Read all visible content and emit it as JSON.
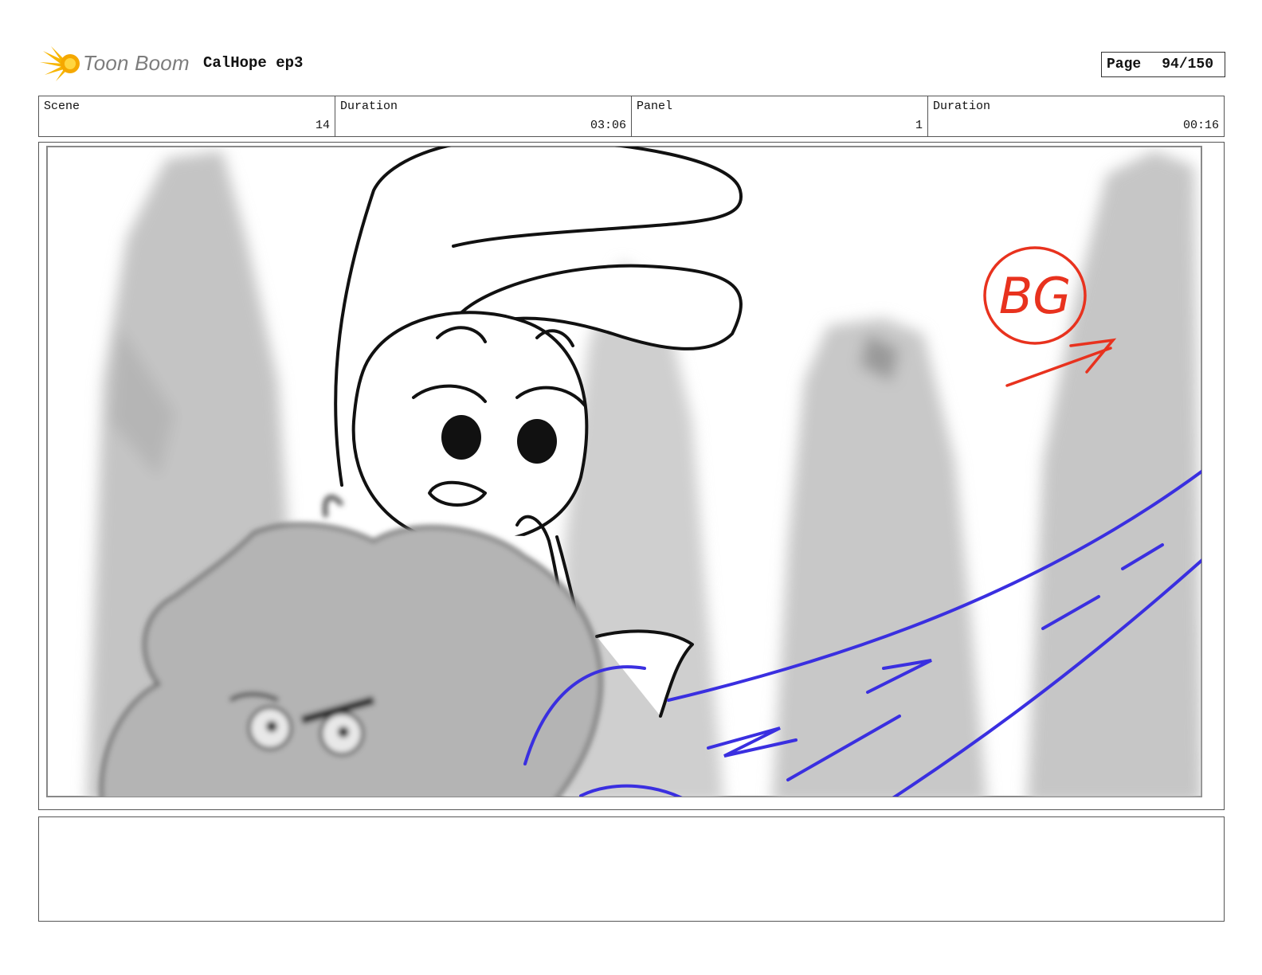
{
  "header": {
    "logo_text": "Toon Boom",
    "project_title": "CalHope ep3",
    "page_label": "Page",
    "page_number": "94/150"
  },
  "info": {
    "scene_label": "Scene",
    "scene_value": "14",
    "scene_duration_label": "Duration",
    "scene_duration_value": "03:06",
    "panel_label": "Panel",
    "panel_value": "1",
    "panel_duration_label": "Duration",
    "panel_duration_value": "00:16"
  },
  "panel": {
    "annotation": "BG",
    "colors": {
      "annotation_red": "#e8321e",
      "effect_blue": "#3a2fe0",
      "background_gray": "#c8c8c8",
      "foreground_gray": "#a9a9a9"
    }
  }
}
